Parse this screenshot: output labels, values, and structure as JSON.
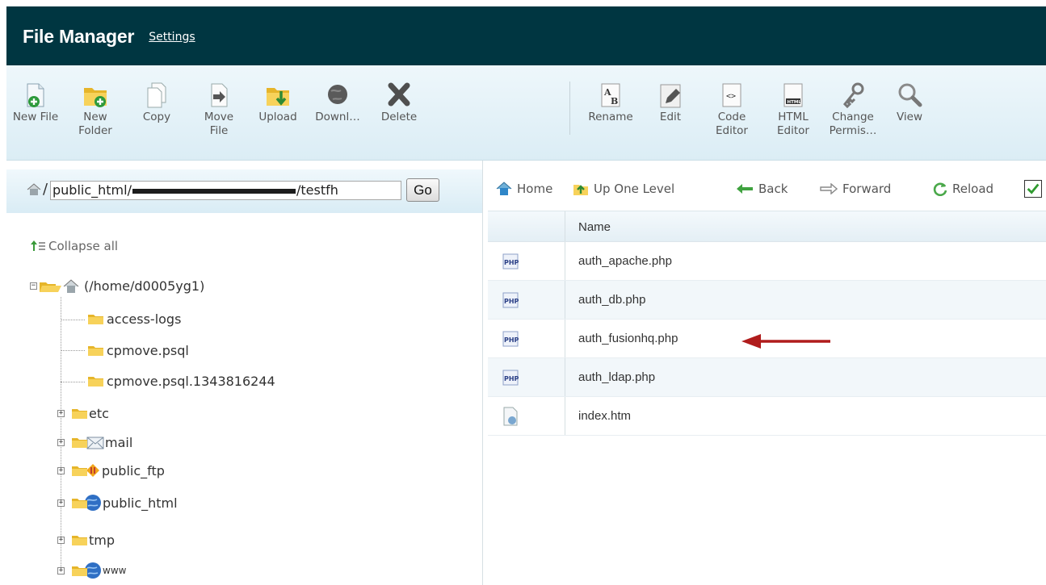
{
  "header": {
    "title": "File Manager",
    "settings": "Settings"
  },
  "toolbar": {
    "new_file": "New File",
    "new_folder": [
      "New",
      "Folder"
    ],
    "copy": "Copy",
    "move_file": [
      "Move",
      "File"
    ],
    "upload": "Upload",
    "download": "Downl…",
    "delete": "Delete",
    "rename": "Rename",
    "edit": "Edit",
    "code_editor": [
      "Code",
      "Editor"
    ],
    "html_editor": [
      "HTML",
      "Editor"
    ],
    "change_perms": [
      "Change",
      "Permis…"
    ],
    "view": "View"
  },
  "pathbar": {
    "slash": "/",
    "path_prefix": "public_html/",
    "path_suffix": "/testfh",
    "go": "Go"
  },
  "tree": {
    "collapse_all": "Collapse all",
    "root": "(/home/d0005yg1)",
    "items": [
      "access-logs",
      "cpmove.psql",
      "cpmove.psql.1343816244",
      "etc",
      "mail",
      "public_ftp",
      "public_html",
      "tmp",
      "www"
    ]
  },
  "nav": {
    "home": "Home",
    "up": "Up One Level",
    "back": "Back",
    "forward": "Forward",
    "reload": "Reload"
  },
  "table": {
    "column_name": "Name",
    "files": [
      {
        "name": "auth_apache.php",
        "icon": "php-file-icon"
      },
      {
        "name": "auth_db.php",
        "icon": "php-file-icon"
      },
      {
        "name": "auth_fusionhq.php",
        "icon": "php-file-icon"
      },
      {
        "name": "auth_ldap.php",
        "icon": "php-file-icon"
      },
      {
        "name": "index.htm",
        "icon": "html-file-icon"
      }
    ]
  },
  "colors": {
    "header_bg": "#003641",
    "folder": "#f5c33b",
    "arrow": "#b01c1c"
  }
}
